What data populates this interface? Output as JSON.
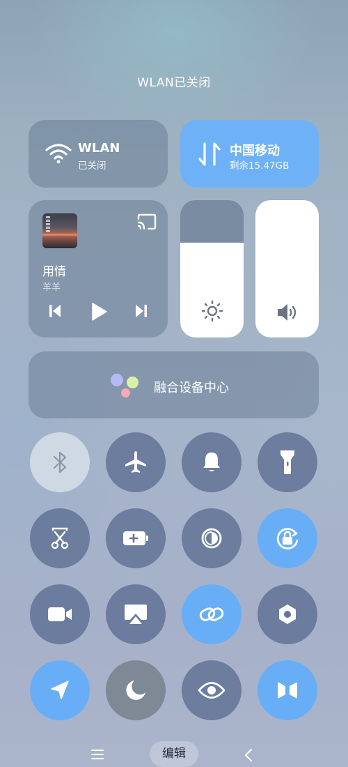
{
  "status": {
    "title": "WLAN已关闭"
  },
  "wlan": {
    "title": "WLAN",
    "subtitle": "已关闭",
    "icon": "wifi-icon",
    "state": "off"
  },
  "mobile": {
    "title": "中国移动",
    "subtitle": "剩余15.47GB",
    "icon": "mobile-data-icon",
    "state": "on",
    "color": "#6fb1f6"
  },
  "media": {
    "song": "用情",
    "artist": "羊羊",
    "controls": [
      "previous-icon",
      "play-icon",
      "next-icon"
    ],
    "cast_icon": "cast-icon"
  },
  "brightness": {
    "level": 0.69,
    "icon": "sun-icon"
  },
  "volume": {
    "level": 1.0,
    "icon": "speaker-icon"
  },
  "device_center": {
    "label": "融合设备中心",
    "dot_colors": [
      "#b7b8f5",
      "#d9f0a8",
      "#f6a9b6"
    ]
  },
  "toggles": [
    {
      "name": "bluetooth",
      "icon": "bluetooth-icon",
      "state": "off-light"
    },
    {
      "name": "airplane",
      "icon": "airplane-icon",
      "state": "off"
    },
    {
      "name": "sound",
      "icon": "bell-icon",
      "state": "off"
    },
    {
      "name": "flashlight",
      "icon": "flashlight-icon",
      "state": "off"
    },
    {
      "name": "screenshot",
      "icon": "scissors-icon",
      "state": "off"
    },
    {
      "name": "battery-saver",
      "icon": "battery-plus-icon",
      "state": "off"
    },
    {
      "name": "dark-mode",
      "icon": "contrast-icon",
      "state": "off"
    },
    {
      "name": "auto-rotate",
      "icon": "rotate-lock-icon",
      "state": "on"
    },
    {
      "name": "video",
      "icon": "video-camera-icon",
      "state": "off"
    },
    {
      "name": "screen-cast",
      "icon": "screencast-icon",
      "state": "off"
    },
    {
      "name": "link",
      "icon": "link-icon",
      "state": "on"
    },
    {
      "name": "settings",
      "icon": "hexagon-settings-icon",
      "state": "off"
    },
    {
      "name": "location",
      "icon": "location-arrow-icon",
      "state": "on"
    },
    {
      "name": "do-not-disturb",
      "icon": "moon-icon",
      "state": "off-grey"
    },
    {
      "name": "eye-comfort",
      "icon": "eye-icon",
      "state": "off"
    },
    {
      "name": "nearby-share",
      "icon": "bowtie-icon",
      "state": "on"
    }
  ],
  "nav": {
    "edit_label": "编辑",
    "menu_icon": "menu-icon",
    "back_icon": "back-icon"
  },
  "colors": {
    "accent": "#6fb1f6"
  }
}
